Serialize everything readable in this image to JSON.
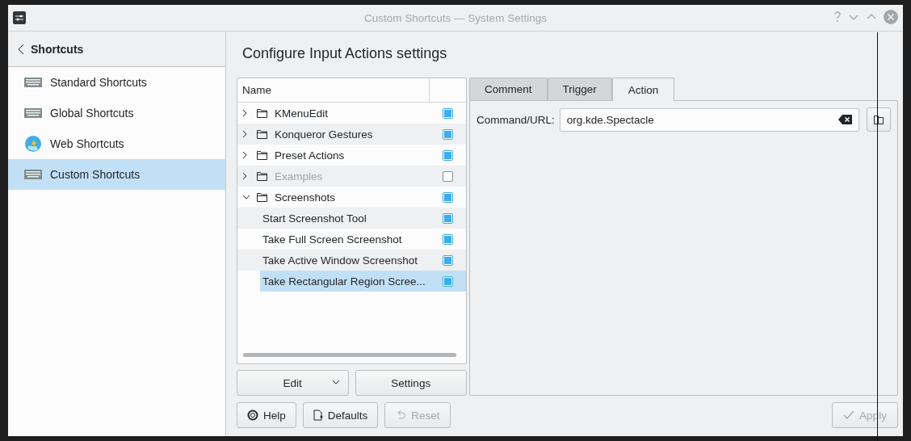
{
  "window": {
    "title": "Custom Shortcuts — System Settings"
  },
  "sidebar": {
    "back_label": "Shortcuts",
    "items": [
      {
        "label": "Standard Shortcuts",
        "kind": "keyboard",
        "selected": false
      },
      {
        "label": "Global Shortcuts",
        "kind": "keyboard",
        "selected": false
      },
      {
        "label": "Web Shortcuts",
        "kind": "globe",
        "selected": false
      },
      {
        "label": "Custom Shortcuts",
        "kind": "keyboard",
        "selected": true
      }
    ]
  },
  "page_title": "Configure Input Actions settings",
  "tree": {
    "column_1": "Name",
    "items": [
      {
        "label": "KMenuEdit",
        "expanded": false,
        "checked": true,
        "disabled": false,
        "selected": false
      },
      {
        "label": "Konqueror Gestures",
        "expanded": false,
        "checked": true,
        "disabled": false,
        "selected": false
      },
      {
        "label": "Preset Actions",
        "expanded": false,
        "checked": true,
        "disabled": false,
        "selected": false
      },
      {
        "label": "Examples",
        "expanded": false,
        "checked": false,
        "disabled": true,
        "selected": false
      },
      {
        "label": "Screenshots",
        "expanded": true,
        "checked": true,
        "disabled": false,
        "selected": false,
        "children": [
          {
            "label": "Start Screenshot Tool",
            "checked": true,
            "selected": false
          },
          {
            "label": "Take Full Screen Screenshot",
            "checked": true,
            "selected": false
          },
          {
            "label": "Take Active Window Screenshot",
            "checked": true,
            "selected": false
          },
          {
            "label": "Take Rectangular Region Scree...",
            "checked": true,
            "selected": true
          }
        ]
      }
    ]
  },
  "tree_buttons": [
    {
      "label": "Edit",
      "kind": "dropdown"
    },
    {
      "label": "Settings",
      "kind": "plain"
    }
  ],
  "tabs": [
    {
      "label": "Comment",
      "selected": false
    },
    {
      "label": "Trigger",
      "selected": false
    },
    {
      "label": "Action",
      "selected": true
    }
  ],
  "action": {
    "label": "Command/URL:",
    "value": "org.kde.Spectacle"
  },
  "buttons": [
    {
      "label": "Help",
      "kind": "help",
      "disabled": false
    },
    {
      "label": "Defaults",
      "kind": "defaults",
      "disabled": false
    },
    {
      "label": "Reset",
      "kind": "reset",
      "disabled": true
    },
    {
      "label": "Apply",
      "kind": "apply",
      "disabled": true
    }
  ]
}
